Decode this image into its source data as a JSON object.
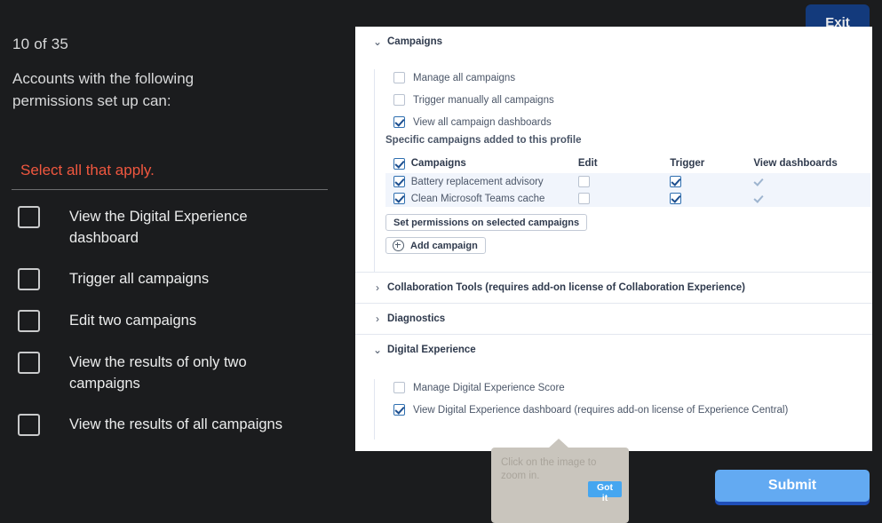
{
  "quiz": {
    "counter": "10 of 35",
    "stem": "Accounts with the following permissions set up can:",
    "instruction": "Select all that apply.",
    "options": [
      {
        "label": "View the Digital Experience dashboard",
        "checked": false
      },
      {
        "label": "Trigger all campaigns",
        "checked": false
      },
      {
        "label": "Edit two campaigns",
        "checked": false
      },
      {
        "label": "View the results of only two campaigns",
        "checked": false
      },
      {
        "label": "View the results of all campaigns",
        "checked": false
      }
    ],
    "exit_label": "Exit",
    "submit_label": "Submit",
    "accent_red": "#f0573f",
    "exit_color": "#133a7c",
    "submit_color": "#63aaf2"
  },
  "panel": {
    "sections": [
      {
        "title": "Campaigns",
        "expanded": true,
        "chevron": "chevron-down-icon",
        "permissions": [
          {
            "label": "Manage all campaigns",
            "checked": false
          },
          {
            "label": "Trigger manually all campaigns",
            "checked": false
          },
          {
            "label": "View all campaign dashboards",
            "checked": true
          }
        ],
        "subnote": "Specific campaigns added to this profile",
        "table": {
          "headers": {
            "select_all": true,
            "name": "Campaigns",
            "edit": "Edit",
            "trigger": "Trigger",
            "view": "View dashboards"
          },
          "rows": [
            {
              "selected": true,
              "name": "Battery replacement advisory",
              "edit": false,
              "trigger": true,
              "view": "tick"
            },
            {
              "selected": true,
              "name": "Clean Microsoft Teams cache",
              "edit": false,
              "trigger": true,
              "view": "tick"
            }
          ]
        },
        "buttons": {
          "set_permissions": "Set permissions on selected campaigns",
          "add_campaign": "Add campaign"
        }
      },
      {
        "title": "Collaboration Tools (requires add-on license of Collaboration Experience)",
        "expanded": false,
        "chevron": "chevron-right-icon"
      },
      {
        "title": "Diagnostics",
        "expanded": false,
        "chevron": "chevron-right-icon"
      },
      {
        "title": "Digital Experience",
        "expanded": true,
        "chevron": "chevron-down-icon",
        "permissions": [
          {
            "label": "Manage Digital Experience Score",
            "checked": false
          },
          {
            "label": "View Digital Experience dashboard (requires add-on license of Experience Central)",
            "checked": true
          }
        ]
      }
    ]
  },
  "tooltip": {
    "text": "Click on the image to zoom in.",
    "button_label": "Got it",
    "background": "#c9c5bd",
    "button_color": "#45a6f0"
  }
}
